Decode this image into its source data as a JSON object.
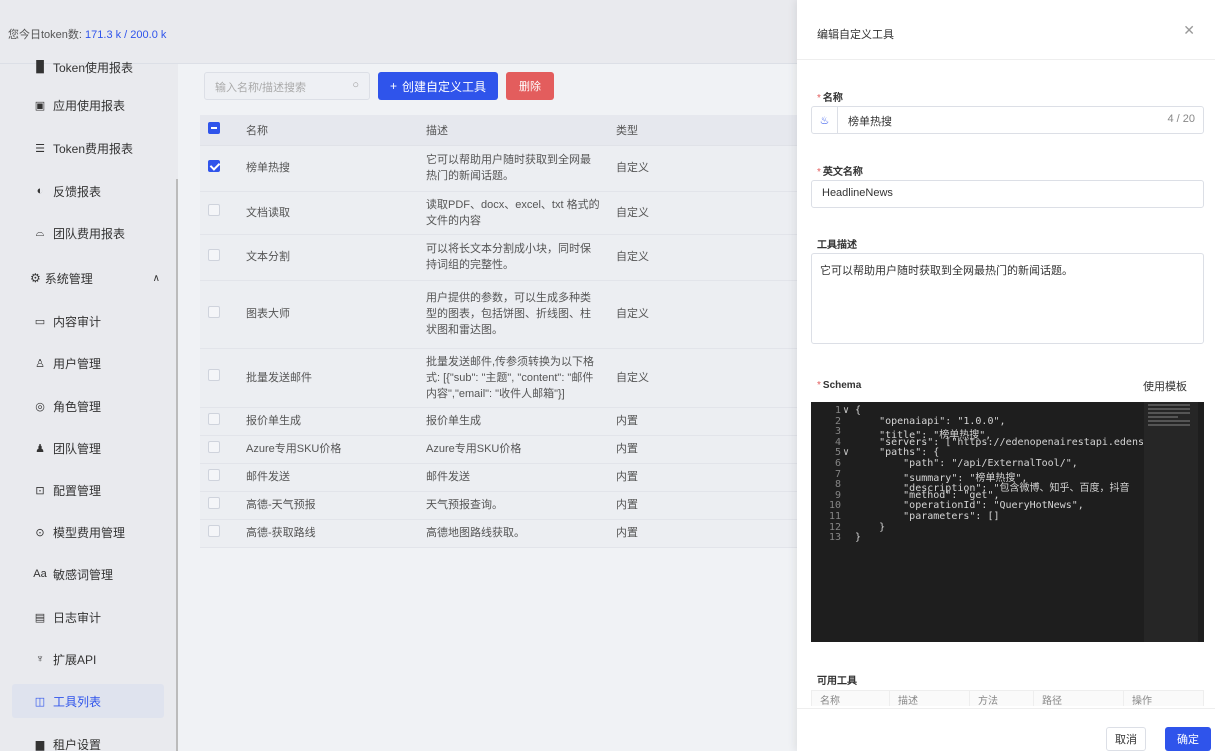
{
  "topbar": {
    "token_label": "您今日token数:",
    "token_value": "171.3 k / 200.0 k"
  },
  "sidebar": {
    "items": [
      {
        "label": "Token使用报表",
        "icon": "bar-chart-icon"
      },
      {
        "label": "应用使用报表",
        "icon": "app-report-icon"
      },
      {
        "label": "Token费用报表",
        "icon": "cost-report-icon"
      },
      {
        "label": "反馈报表",
        "icon": "feedback-icon"
      },
      {
        "label": "团队费用报表",
        "icon": "team-cost-icon"
      },
      {
        "label": "系统管理",
        "icon": "gear-icon"
      },
      {
        "label": "内容审计",
        "icon": "audit-icon"
      },
      {
        "label": "用户管理",
        "icon": "user-icon"
      },
      {
        "label": "角色管理",
        "icon": "role-icon"
      },
      {
        "label": "团队管理",
        "icon": "team-icon"
      },
      {
        "label": "配置管理",
        "icon": "config-icon"
      },
      {
        "label": "模型费用管理",
        "icon": "model-cost-icon"
      },
      {
        "label": "敏感词管理",
        "icon": "sensitive-icon"
      },
      {
        "label": "日志审计",
        "icon": "log-icon"
      },
      {
        "label": "扩展API",
        "icon": "api-icon"
      },
      {
        "label": "工具列表",
        "icon": "tool-list-icon"
      },
      {
        "label": "租户设置",
        "icon": "tenant-icon"
      }
    ]
  },
  "toolbar": {
    "search_placeholder": "输入名称/描述搜索",
    "create_label": "创建自定义工具",
    "delete_label": "删除"
  },
  "table": {
    "headers": [
      "名称",
      "描述",
      "类型"
    ],
    "rows": [
      {
        "name": "榜单热搜",
        "desc": "它可以帮助用户随时获取到全网最热门的新闻话题。",
        "type": "自定义",
        "checked": true
      },
      {
        "name": "文档读取",
        "desc": "读取PDF、docx、excel、txt 格式的文件的内容",
        "type": "自定义",
        "checked": false
      },
      {
        "name": "文本分割",
        "desc": "可以将长文本分割成小块，同时保持词组的完整性。",
        "type": "自定义",
        "checked": false
      },
      {
        "name": "图表大师",
        "desc": "用户提供的参数，可以生成多种类型的图表，包括饼图、折线图、柱状图和雷达图。",
        "type": "自定义",
        "checked": false
      },
      {
        "name": "批量发送邮件",
        "desc": "批量发送邮件,传参须转换为以下格式: [{\"sub\": \"主题\", \"content\": \"邮件内容\",\"email\": \"收件人邮箱\"}]",
        "type": "自定义",
        "checked": false
      },
      {
        "name": "报价单生成",
        "desc": "报价单生成",
        "type": "内置",
        "checked": false
      },
      {
        "name": "Azure专用SKU价格",
        "desc": "Azure专用SKU价格",
        "type": "内置",
        "checked": false
      },
      {
        "name": "邮件发送",
        "desc": "邮件发送",
        "type": "内置",
        "checked": false
      },
      {
        "name": "高德-天气预报",
        "desc": "天气预报查询。",
        "type": "内置",
        "checked": false
      },
      {
        "name": "高德-获取路线",
        "desc": "高德地图路线获取。",
        "type": "内置",
        "checked": false
      }
    ]
  },
  "drawer": {
    "title": "编辑自定义工具",
    "name_label": "名称",
    "name_value": "榜单热搜",
    "name_count": "4 / 20",
    "en_label": "英文名称",
    "en_value": "HeadlineNews",
    "desc_label": "工具描述",
    "desc_value": "它可以帮助用户随时获取到全网最热门的新闻话题。",
    "schema_label": "Schema",
    "template_link": "使用模板",
    "code_lines": [
      "{",
      "    \"openaiapi\": \"1.0.0\",",
      "    \"title\": \"榜单热搜\",",
      "    \"servers\": [\"https://edenopenairestapi.edens",
      "    \"paths\": {",
      "        \"path\": \"/api/ExternalTool/\",",
      "        \"summary\": \"榜单热搜\",",
      "        \"description\": \"包含微博、知乎、百度，抖音",
      "        \"method\": \"get\",",
      "        \"operationId\": \"QueryHotNews\",",
      "        \"parameters\": []",
      "    }",
      "}"
    ],
    "tools_label": "可用工具",
    "tools_headers": [
      "名称",
      "描述",
      "方法",
      "路径",
      "操作"
    ],
    "cancel_label": "取消",
    "ok_label": "确定"
  }
}
